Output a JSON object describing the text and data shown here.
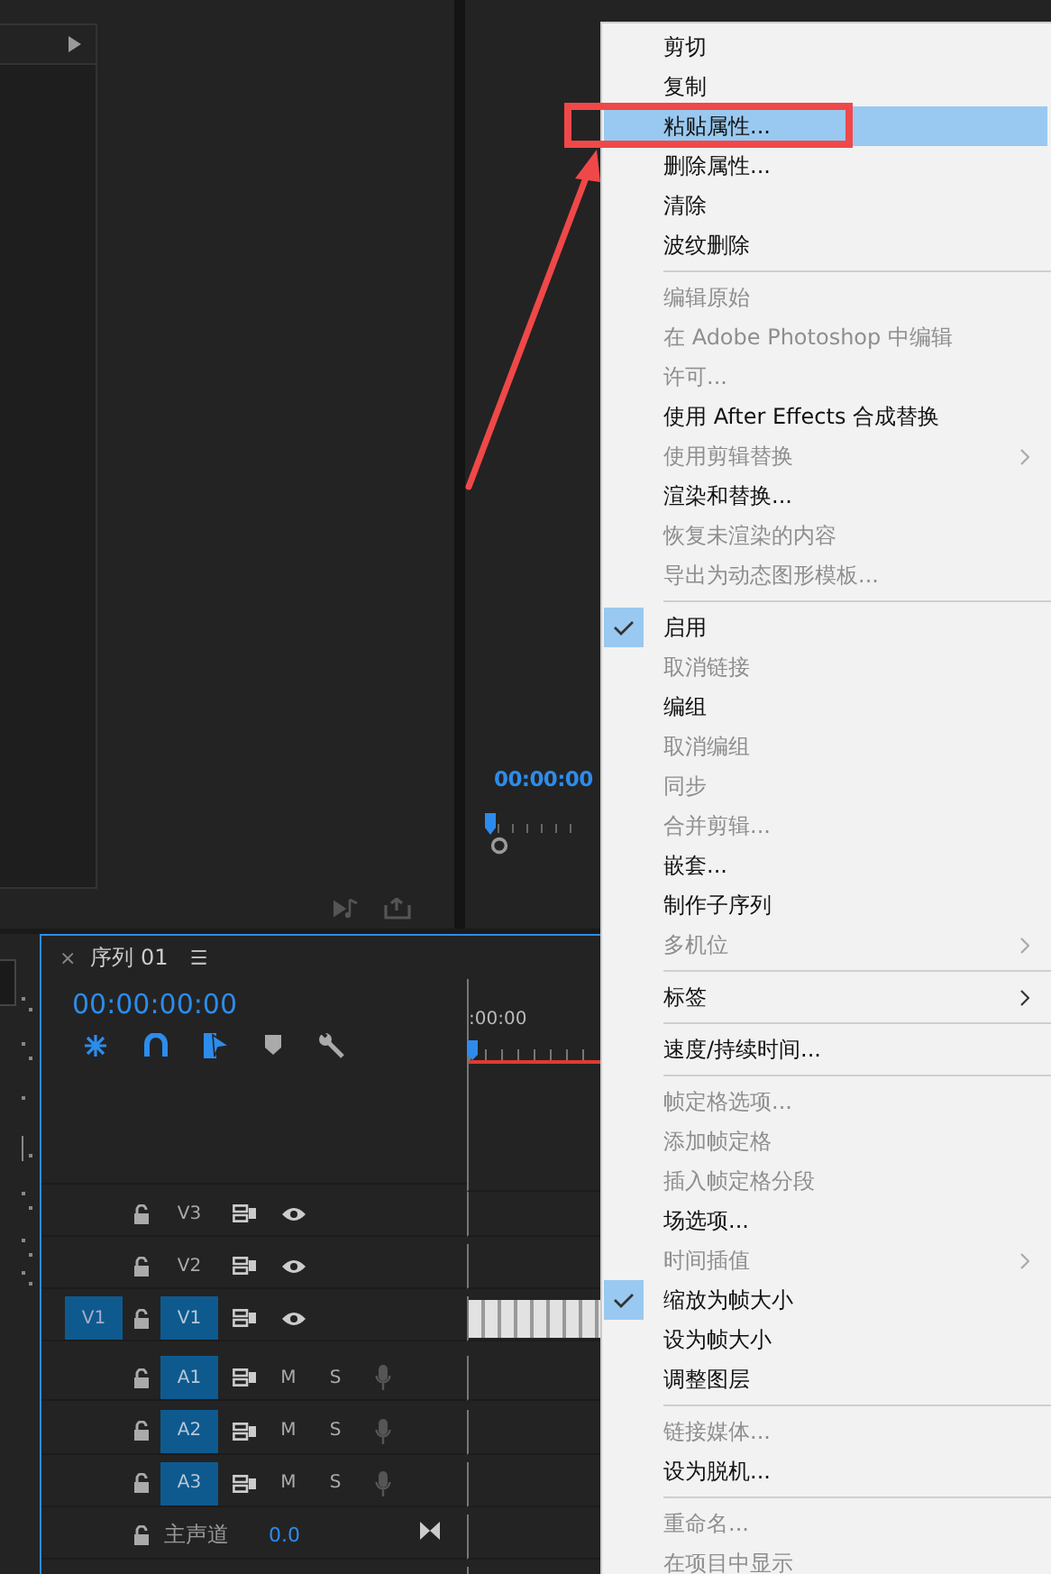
{
  "monitor": {
    "timecode": "00:00:00"
  },
  "timeline": {
    "close": "×",
    "title": "序列 01",
    "menu": "☰",
    "timecode": "00:00:00:00",
    "ruler_label": ":00:00",
    "tracks": [
      {
        "name": "V3",
        "kind": "video",
        "targeted": false
      },
      {
        "name": "V2",
        "kind": "video",
        "targeted": false
      },
      {
        "name": "V1",
        "kind": "video",
        "targeted": true,
        "source": "V1",
        "clip": true
      },
      {
        "name": "A1",
        "kind": "audio",
        "targeted": true,
        "mute": "M",
        "solo": "S"
      },
      {
        "name": "A2",
        "kind": "audio",
        "targeted": true,
        "mute": "M",
        "solo": "S"
      },
      {
        "name": "A3",
        "kind": "audio",
        "targeted": true,
        "mute": "M",
        "solo": "S"
      }
    ],
    "master": {
      "label": "主声道",
      "value": "0.0"
    }
  },
  "context_menu": [
    {
      "kind": "item",
      "label": "剪切",
      "disabled": false,
      "checked": false,
      "submenu": false,
      "selected": false
    },
    {
      "kind": "item",
      "label": "复制",
      "disabled": false,
      "checked": false,
      "submenu": false,
      "selected": false
    },
    {
      "kind": "item",
      "label": "粘贴属性...",
      "disabled": false,
      "checked": false,
      "submenu": false,
      "selected": true
    },
    {
      "kind": "item",
      "label": "删除属性...",
      "disabled": false,
      "checked": false,
      "submenu": false,
      "selected": false
    },
    {
      "kind": "item",
      "label": "清除",
      "disabled": false,
      "checked": false,
      "submenu": false,
      "selected": false
    },
    {
      "kind": "item",
      "label": "波纹删除",
      "disabled": false,
      "checked": false,
      "submenu": false,
      "selected": false
    },
    {
      "kind": "separator"
    },
    {
      "kind": "item",
      "label": "编辑原始",
      "disabled": true,
      "checked": false,
      "submenu": false,
      "selected": false
    },
    {
      "kind": "item",
      "label": "在 Adobe Photoshop 中编辑",
      "disabled": true,
      "checked": false,
      "submenu": false,
      "selected": false
    },
    {
      "kind": "item",
      "label": "许可...",
      "disabled": true,
      "checked": false,
      "submenu": false,
      "selected": false
    },
    {
      "kind": "item",
      "label": "使用 After Effects 合成替换",
      "disabled": false,
      "checked": false,
      "submenu": false,
      "selected": false
    },
    {
      "kind": "item",
      "label": "使用剪辑替换",
      "disabled": true,
      "checked": false,
      "submenu": true,
      "selected": false
    },
    {
      "kind": "item",
      "label": "渲染和替换...",
      "disabled": false,
      "checked": false,
      "submenu": false,
      "selected": false
    },
    {
      "kind": "item",
      "label": "恢复未渲染的内容",
      "disabled": true,
      "checked": false,
      "submenu": false,
      "selected": false
    },
    {
      "kind": "item",
      "label": "导出为动态图形模板...",
      "disabled": true,
      "checked": false,
      "submenu": false,
      "selected": false
    },
    {
      "kind": "separator"
    },
    {
      "kind": "item",
      "label": "启用",
      "disabled": false,
      "checked": true,
      "submenu": false,
      "selected": false
    },
    {
      "kind": "item",
      "label": "取消链接",
      "disabled": true,
      "checked": false,
      "submenu": false,
      "selected": false
    },
    {
      "kind": "item",
      "label": "编组",
      "disabled": false,
      "checked": false,
      "submenu": false,
      "selected": false
    },
    {
      "kind": "item",
      "label": "取消编组",
      "disabled": true,
      "checked": false,
      "submenu": false,
      "selected": false
    },
    {
      "kind": "item",
      "label": "同步",
      "disabled": true,
      "checked": false,
      "submenu": false,
      "selected": false
    },
    {
      "kind": "item",
      "label": "合并剪辑...",
      "disabled": true,
      "checked": false,
      "submenu": false,
      "selected": false
    },
    {
      "kind": "item",
      "label": "嵌套...",
      "disabled": false,
      "checked": false,
      "submenu": false,
      "selected": false
    },
    {
      "kind": "item",
      "label": "制作子序列",
      "disabled": false,
      "checked": false,
      "submenu": false,
      "selected": false
    },
    {
      "kind": "item",
      "label": "多机位",
      "disabled": true,
      "checked": false,
      "submenu": true,
      "selected": false
    },
    {
      "kind": "separator"
    },
    {
      "kind": "item",
      "label": "标签",
      "disabled": false,
      "checked": false,
      "submenu": true,
      "selected": false
    },
    {
      "kind": "separator"
    },
    {
      "kind": "item",
      "label": "速度/持续时间...",
      "disabled": false,
      "checked": false,
      "submenu": false,
      "selected": false
    },
    {
      "kind": "separator"
    },
    {
      "kind": "item",
      "label": "帧定格选项...",
      "disabled": true,
      "checked": false,
      "submenu": false,
      "selected": false
    },
    {
      "kind": "item",
      "label": "添加帧定格",
      "disabled": true,
      "checked": false,
      "submenu": false,
      "selected": false
    },
    {
      "kind": "item",
      "label": "插入帧定格分段",
      "disabled": true,
      "checked": false,
      "submenu": false,
      "selected": false
    },
    {
      "kind": "item",
      "label": "场选项...",
      "disabled": false,
      "checked": false,
      "submenu": false,
      "selected": false
    },
    {
      "kind": "item",
      "label": "时间插值",
      "disabled": true,
      "checked": false,
      "submenu": true,
      "selected": false
    },
    {
      "kind": "item",
      "label": "缩放为帧大小",
      "disabled": false,
      "checked": true,
      "submenu": false,
      "selected": false
    },
    {
      "kind": "item",
      "label": "设为帧大小",
      "disabled": false,
      "checked": false,
      "submenu": false,
      "selected": false
    },
    {
      "kind": "item",
      "label": "调整图层",
      "disabled": false,
      "checked": false,
      "submenu": false,
      "selected": false
    },
    {
      "kind": "separator"
    },
    {
      "kind": "item",
      "label": "链接媒体...",
      "disabled": true,
      "checked": false,
      "submenu": false,
      "selected": false
    },
    {
      "kind": "item",
      "label": "设为脱机...",
      "disabled": false,
      "checked": false,
      "submenu": false,
      "selected": false
    },
    {
      "kind": "separator"
    },
    {
      "kind": "item",
      "label": "重命名...",
      "disabled": true,
      "checked": false,
      "submenu": false,
      "selected": false
    },
    {
      "kind": "item",
      "label": "在项目中显示",
      "disabled": true,
      "checked": false,
      "submenu": false,
      "selected": false
    }
  ]
}
